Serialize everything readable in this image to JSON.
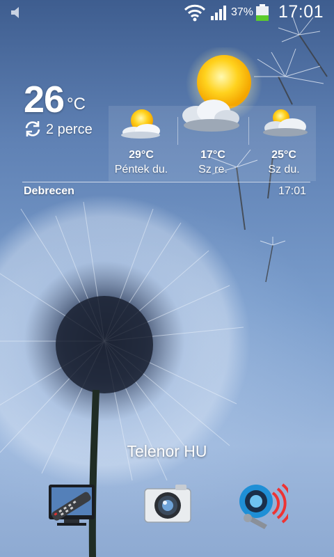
{
  "status_bar": {
    "notification_icon": "volume-icon",
    "wifi_icon": "wifi-icon",
    "signal_icon": "signal-icon",
    "battery_percent": "37%",
    "battery_level": 0.37,
    "time": "17:01"
  },
  "weather": {
    "current_temp": "26",
    "unit": "°C",
    "refresh_icon": "refresh-icon",
    "updated_ago": "2 perce",
    "city": "Debrecen",
    "update_time": "17:01",
    "current_icon": "sun-icon",
    "forecast": [
      {
        "temp": "29°C",
        "day": "Péntek du.",
        "icon": "sun-cloud-icon"
      },
      {
        "temp": "17°C",
        "day": "Sz re.",
        "icon": "cloud-icon"
      },
      {
        "temp": "25°C",
        "day": "Sz du.",
        "icon": "sun-cloud-icon"
      }
    ]
  },
  "home": {
    "carrier_label": "Telenor HU",
    "dock": [
      {
        "icon": "tv-remote-app-icon"
      },
      {
        "icon": "camera-app-icon"
      },
      {
        "icon": "ip-cam-app-icon"
      }
    ]
  },
  "colors": {
    "sky_top": "#3e5d8f",
    "sky_bottom": "#9db8dd",
    "battery_green": "#5bcb2c",
    "sun_yellow": "#ffd21e"
  }
}
